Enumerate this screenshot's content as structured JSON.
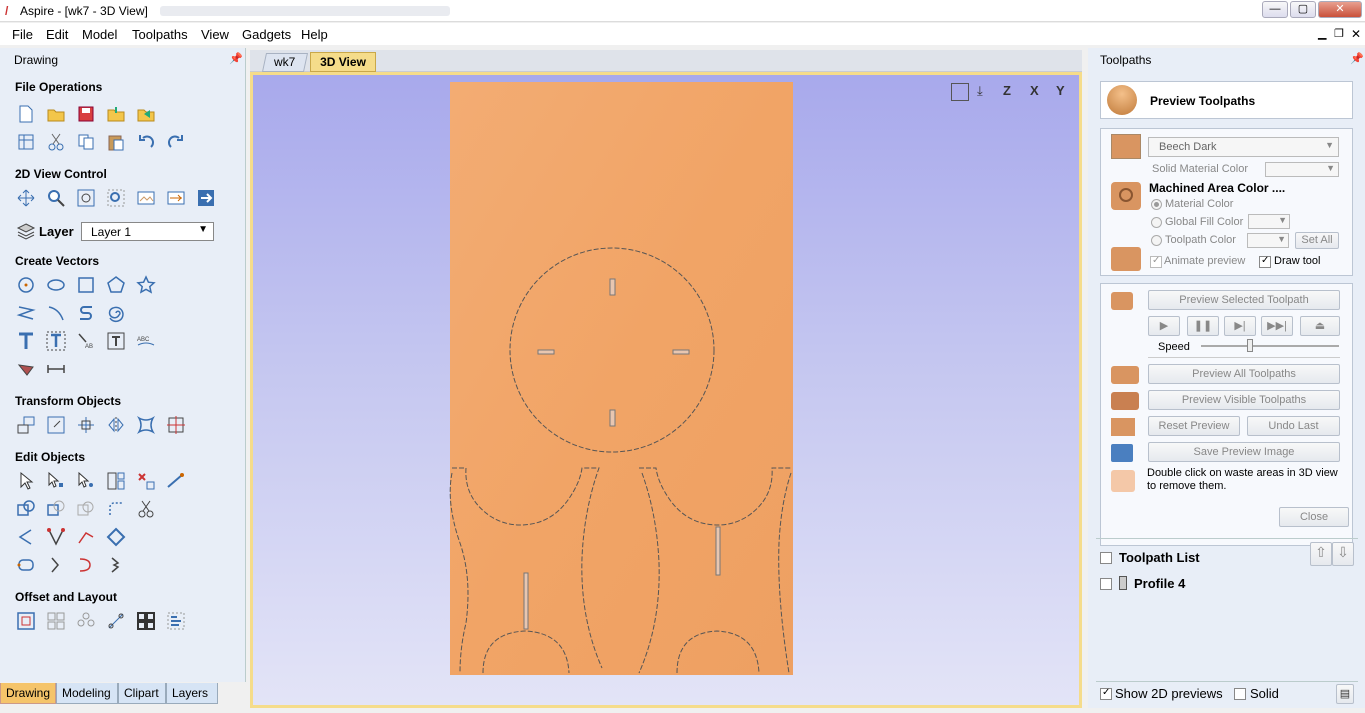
{
  "window": {
    "title": "Aspire - [wk7 - 3D View]",
    "min": "—",
    "max": "▢",
    "close": "✕"
  },
  "menu": [
    "File",
    "Edit",
    "Model",
    "Toolpaths",
    "View",
    "Gadgets",
    "Help"
  ],
  "left": {
    "title": "Drawing",
    "sections": {
      "file_ops": "File Operations",
      "view2d": "2D View Control",
      "create": "Create Vectors",
      "transform": "Transform Objects",
      "edit": "Edit Objects",
      "offset": "Offset and Layout"
    },
    "layer_label": "Layer",
    "layer_value": "Layer 1",
    "tabs": [
      "Drawing",
      "Modeling",
      "Clipart",
      "Layers"
    ]
  },
  "doc_tabs": [
    "wk7",
    "3D View"
  ],
  "view_toolbar": [
    "zoom-extents",
    "iso",
    "Z",
    "X",
    "Y"
  ],
  "right": {
    "title": "Toolpaths",
    "header": "Preview Toolpaths",
    "material": "Beech Dark",
    "solid_color": "Solid Material Color",
    "machined_title": "Machined Area Color ....",
    "material_color": "Material Color",
    "global_fill": "Global Fill Color",
    "toolpath_color": "Toolpath Color",
    "set_all": "Set All",
    "animate": "Animate preview",
    "draw_tool": "Draw tool",
    "preview_selected": "Preview Selected Toolpath",
    "speed": "Speed",
    "speed_level": 0.35,
    "preview_all": "Preview All Toolpaths",
    "preview_visible": "Preview Visible Toolpaths",
    "reset": "Reset Preview",
    "undo": "Undo Last",
    "save_image": "Save Preview Image",
    "hint": "Double click on waste areas in 3D view to remove them.",
    "close": "Close",
    "toolpath_list": "Toolpath List",
    "profile": "Profile 4",
    "show2d": "Show 2D previews",
    "solid": "Solid"
  },
  "colors": {
    "accent": "#f5dc8a",
    "wood": "#f2a66c",
    "view_top": "#a8a9ec",
    "view_bottom": "#e3e4f7"
  }
}
